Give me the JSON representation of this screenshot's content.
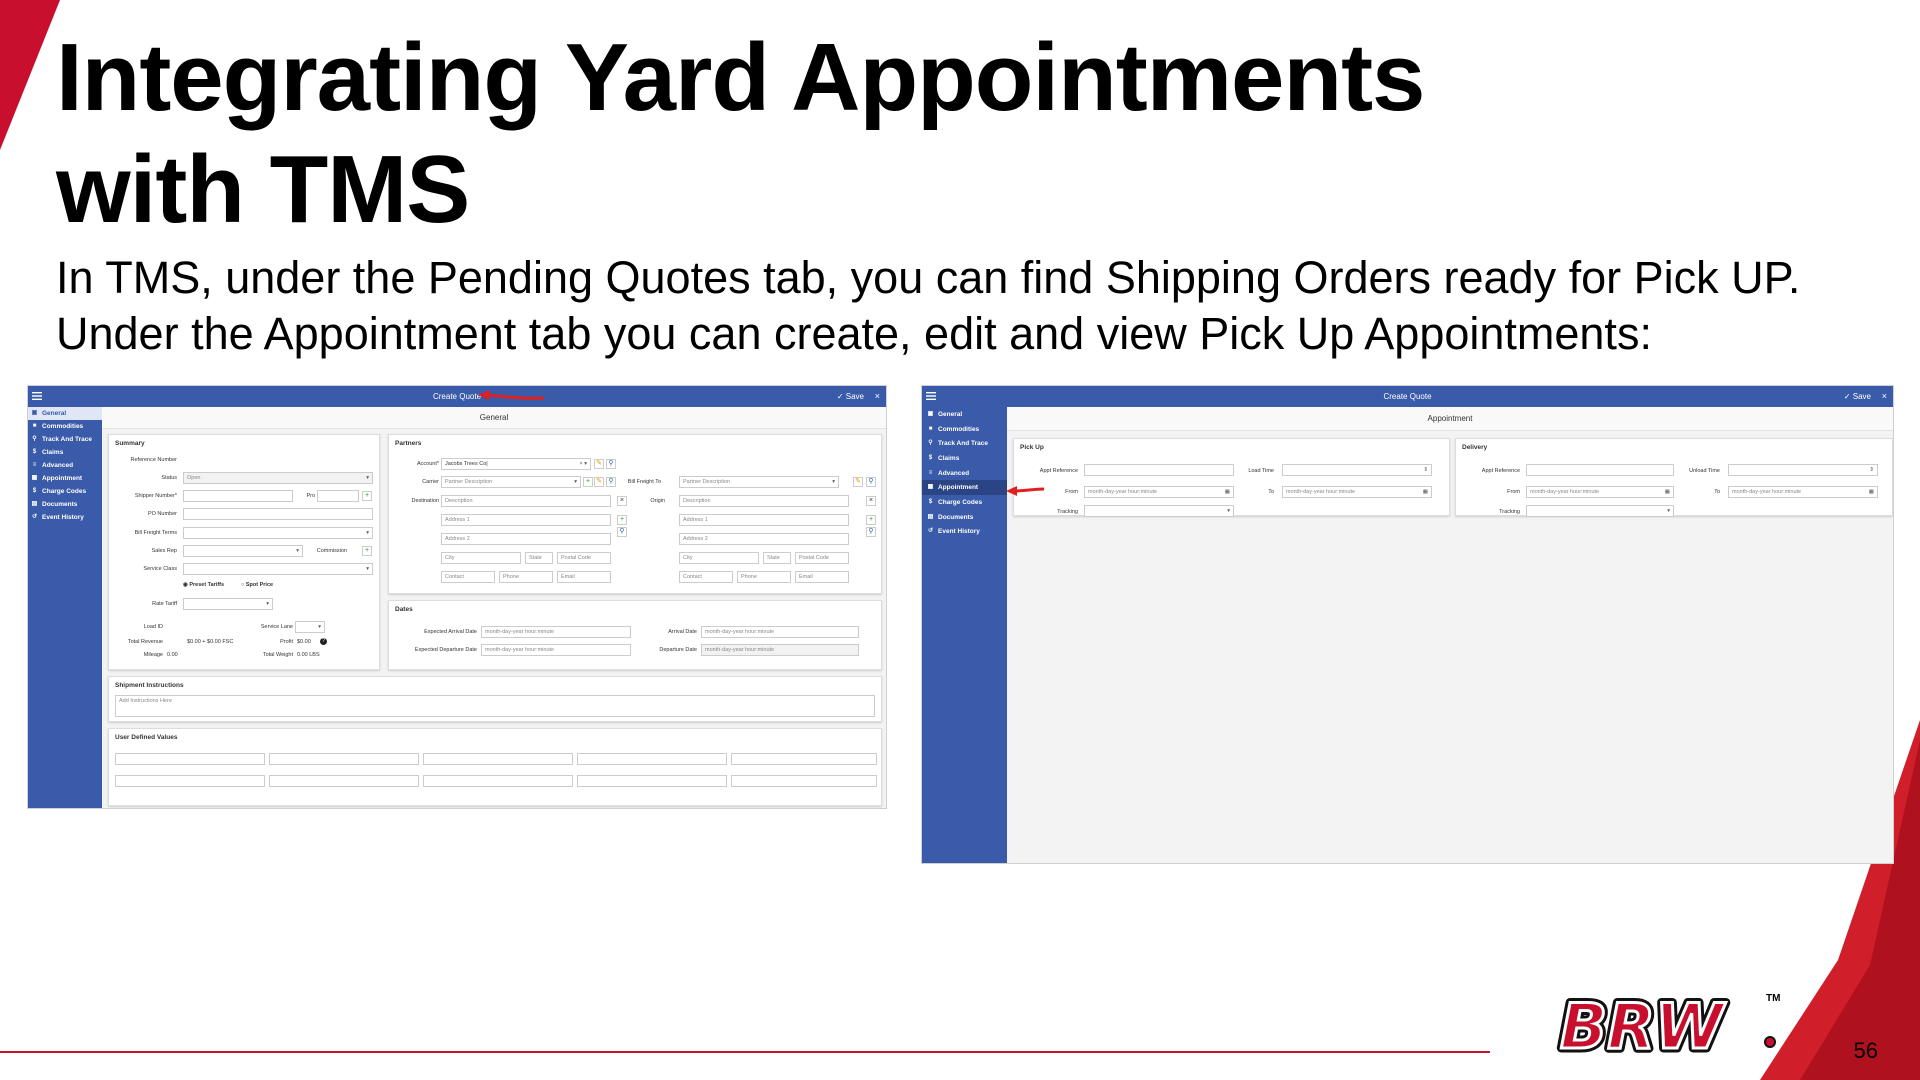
{
  "slide": {
    "title_line1": "Integrating Yard Appointments",
    "title_line2": "with TMS",
    "subtitle": "In TMS, under the Pending Quotes tab, you can find Shipping Orders ready for Pick UP. Under the Appointment tab you can create, edit and view Pick Up Appointments:",
    "page_number": "56",
    "logo_text": "BRW",
    "trademark": "TM"
  },
  "colors": {
    "accent_red": "#c8102e",
    "app_blue": "#3a5ba9"
  },
  "left_screen": {
    "header_title": "Create Quote",
    "save_label": "Save",
    "close_label": "×",
    "section_title": "General",
    "sidebar": [
      "General",
      "Commodities",
      "Track And Trace",
      "Claims",
      "Advanced",
      "Appointment",
      "Charge Codes",
      "Documents",
      "Event History"
    ],
    "summary": {
      "heading": "Summary",
      "reference_number": "Reference Number",
      "status_label": "Status",
      "status_value": "Open",
      "shipper_number": "Shipper Number*",
      "pro": "Pro",
      "po_number": "PO Number",
      "bill_freight_terms": "Bill Freight Terms",
      "sales_rep": "Sales Rep",
      "commission": "Commission",
      "service_class": "Service Class",
      "preset_tariffs": "Preset Tariffs",
      "spot_price": "Spot Price",
      "rate_tariff": "Rate Tariff",
      "load_id": "Load ID",
      "service_lane": "Service Lane",
      "total_revenue_label": "Total Revenue",
      "total_revenue_value": "$0.00 + $0.00 FSC",
      "profit_label": "Profit",
      "profit_value": "$0.00",
      "mileage_label": "Mileage",
      "mileage_value": "0.00",
      "total_weight_label": "Total Weight",
      "total_weight_value": "0.00 LBS"
    },
    "partners": {
      "heading": "Partners",
      "account_label": "Account*",
      "account_value": "Jacobs Trees Co|",
      "carrier_label": "Carrier",
      "partner_description": "Partner Description",
      "bill_freight_to": "Bill Freight To",
      "destination": "Destination",
      "origin": "Origin",
      "description": "Description",
      "address1": "Address 1",
      "address2": "Address 2",
      "city": "City",
      "state": "State",
      "postal_code": "Postal Code",
      "contact": "Contact",
      "phone": "Phone",
      "email": "Email"
    },
    "dates": {
      "heading": "Dates",
      "expected_arrival": "Expected Arrival Date",
      "expected_departure": "Expected Departure Date",
      "arrival": "Arrival Date",
      "departure": "Departure Date",
      "placeholder": "month-day-year hour:minute"
    },
    "shipment_instructions": {
      "heading": "Shipment Instructions",
      "placeholder": "Add Instructions Here"
    },
    "user_defined_values": {
      "heading": "User Defined Values"
    }
  },
  "right_screen": {
    "header_title": "Create Quote",
    "save_label": "Save",
    "close_label": "×",
    "section_title": "Appointment",
    "sidebar": [
      "General",
      "Commodities",
      "Track And Trace",
      "Claims",
      "Advanced",
      "Appointment",
      "Charge Codes",
      "Documents",
      "Event History"
    ],
    "pickup": {
      "heading": "Pick Up",
      "appt_reference": "Appt Reference",
      "load_time": "Load Time",
      "from": "From",
      "to": "To",
      "tracking": "Tracking",
      "placeholder": "month-day-year hour:minute"
    },
    "delivery": {
      "heading": "Delivery",
      "appt_reference": "Appt Reference",
      "unload_time": "Unload Time",
      "from": "From",
      "to": "To",
      "tracking": "Tracking",
      "placeholder": "month-day-year hour:minute"
    }
  }
}
